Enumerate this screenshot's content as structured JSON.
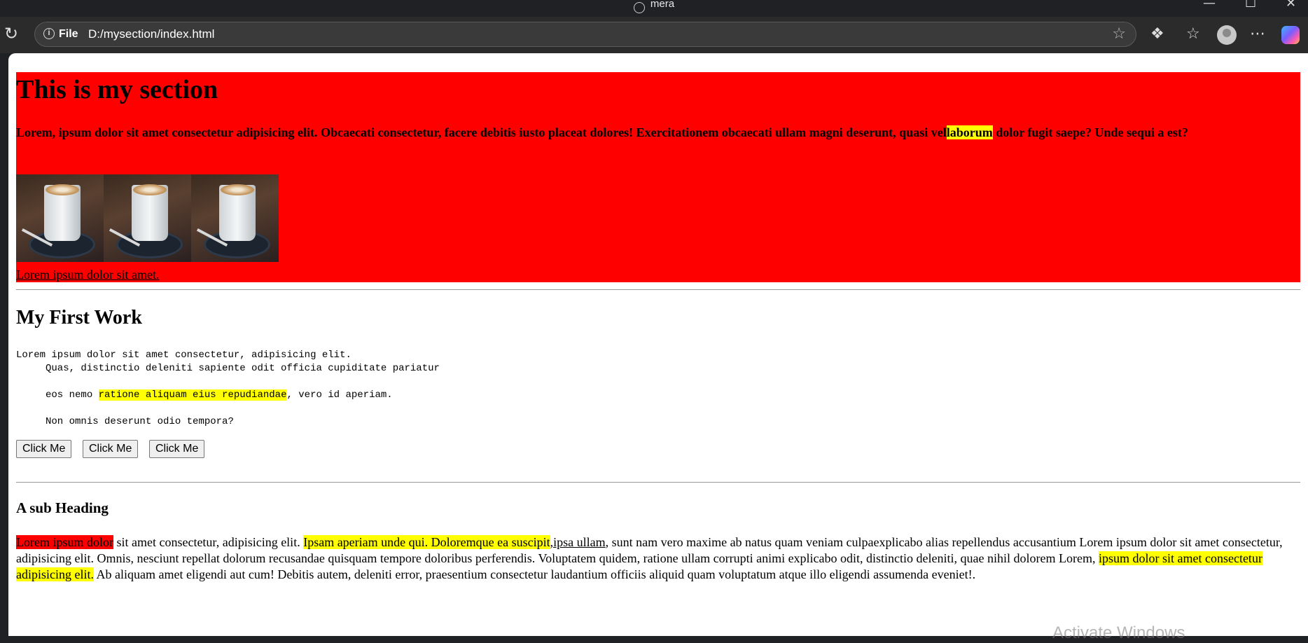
{
  "window": {
    "title": "mera"
  },
  "toolbar": {
    "scheme_label": "File",
    "url": "D:/mysection/index.html"
  },
  "section": {
    "heading": "This is my section",
    "lead_before": "Lorem, ipsum dolor sit amet consectetur adipisicing elit. Obcaecati consectetur, facere debitis iusto placeat dolores! Exercitationem obcaecati ullam magni deserunt, quasi vel",
    "lead_highlight": "laborum",
    "lead_after": " dolor fugit saepe? Unde sequi a est?",
    "link_text": "Lorem ipsum dolor sit amet."
  },
  "work": {
    "heading": "My First Work",
    "line1": "Lorem ipsum dolor sit amet consectetur, adipisicing elit.",
    "line2": "     Quas, distinctio deleniti sapiente odit officia cupiditate pariatur",
    "line3_before": "     eos nemo ",
    "line3_highlight": "ratione aliquam eius repudiandae",
    "line3_after": ", vero id aperiam.",
    "line4": "     Non omnis deserunt odio tempora?",
    "buttons": [
      "Click Me",
      "Click Me",
      "Click Me"
    ]
  },
  "sub": {
    "heading": "A sub Heading",
    "red_highlight": "Lorem ipsum dolor",
    "text1": " sit amet consectetur, adipisicing elit. ",
    "yellow1": "Ipsam aperiam unde qui. Doloremque ea suscipit",
    "link": ",ipsa ullam",
    "text2": ", sunt nam vero maxime ab natus quam veniam culpaexplicabo alias repellendus accusantium Lorem ipsum dolor sit amet consectetur, adipisicing elit. Omnis, nesciunt repellat dolorum recusandae quisquam tempore doloribus perferendis. Voluptatem quidem, ratione ullam corrupti animi explicabo odit, distinctio deleniti, quae nihil dolorem Lorem, ",
    "yellow2": "ipsum dolor sit amet consectetur adipisicing elit.",
    "text3": " Ab aliquam amet eligendi aut cum! Debitis autem, deleniti error, praesentium consectetur laudantium officiis aliquid quam voluptatum atque illo eligendi assumenda eveniet!."
  },
  "watermark": "Activate Windows",
  "colors": {
    "section_bg": "#ff0000",
    "highlight_yellow": "#ffff00",
    "highlight_red": "#ff0000",
    "browser_chrome": "#2b2b2b"
  },
  "icons": [
    "globe-icon",
    "minimize-icon",
    "maximize-icon",
    "close-icon",
    "reload-icon",
    "info-icon",
    "favorite-star-icon",
    "extensions-icon",
    "favorites-icon",
    "profile-avatar",
    "more-icon",
    "copilot-icon"
  ]
}
